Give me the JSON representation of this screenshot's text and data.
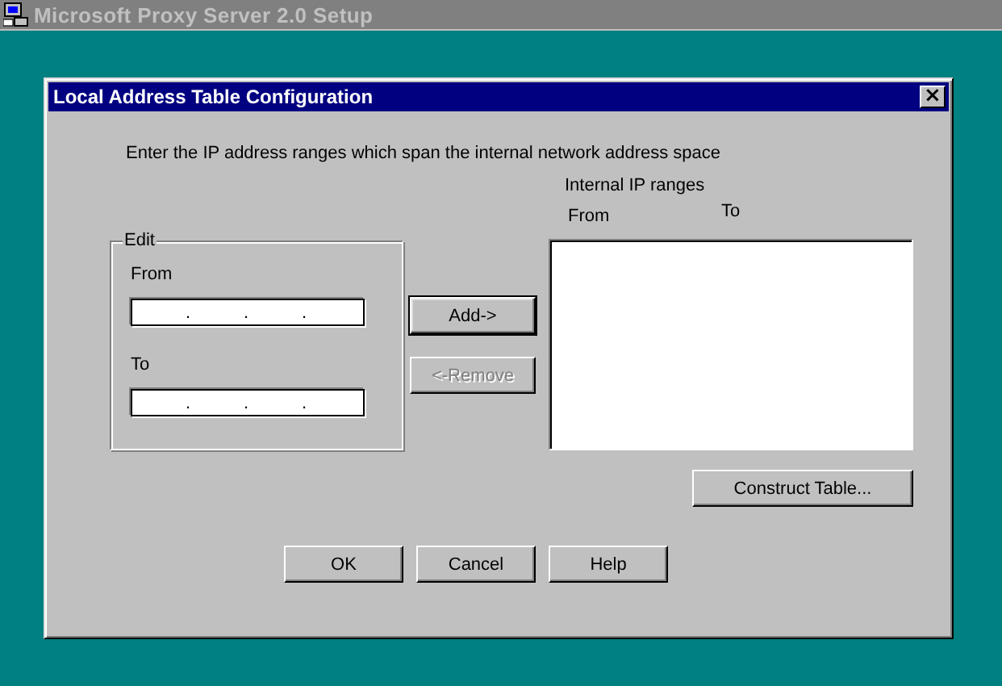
{
  "app_window": {
    "title": "Microsoft Proxy Server 2.0 Setup",
    "active": false
  },
  "dialog": {
    "title": "Local Address Table Configuration",
    "close_button": "×",
    "instruction": "Enter the IP address ranges which span the internal network address space",
    "edit_group": {
      "title": "Edit",
      "fields": [
        {
          "label": "From",
          "separators": [
            ".",
            ".",
            "."
          ]
        },
        {
          "label": "To",
          "separators": [
            ".",
            ".",
            "."
          ]
        }
      ]
    },
    "range_buttons": [
      {
        "label": "Add->",
        "disabled": false,
        "default": true
      },
      {
        "label": "<-Remove",
        "disabled": true,
        "default": false
      }
    ],
    "ranges_list": {
      "title": "Internal IP ranges",
      "columns": [
        "From",
        "To"
      ]
    },
    "construct_button": {
      "label": "Construct Table...",
      "disabled": false
    },
    "buttons": [
      {
        "label": "OK",
        "disabled": false
      },
      {
        "label": "Cancel",
        "disabled": false
      },
      {
        "label": "Help",
        "disabled": false
      }
    ]
  }
}
